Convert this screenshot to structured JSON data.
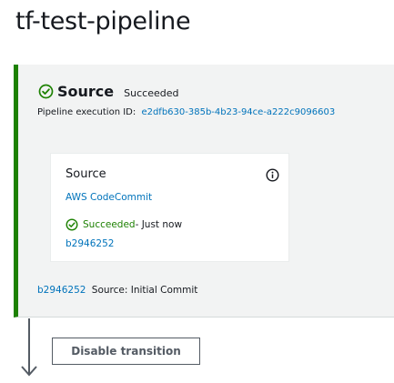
{
  "pipeline": {
    "title": "tf-test-pipeline"
  },
  "colors": {
    "success": "#1d8102",
    "link": "#0073bb",
    "text": "#16191f",
    "stage_background": "#f2f3f3",
    "muted": "#545b64"
  },
  "stage": {
    "icon": "check-circle-icon",
    "name": "Source",
    "status": "Succeeded",
    "execution_label": "Pipeline execution ID:",
    "execution_id": "e2dfb630-385b-4b23-94ce-a222c9096603",
    "action": {
      "name": "Source",
      "info_icon": "info-icon",
      "provider": "AWS CodeCommit",
      "status_icon": "check-circle-icon",
      "status": "Succeeded",
      "time": " - Just now",
      "revision": "b2946252"
    },
    "commit": {
      "id": "b2946252",
      "message": "Source: Initial Commit"
    }
  },
  "transition": {
    "button_label": "Disable transition",
    "arrow_icon": "arrow-down-icon"
  }
}
